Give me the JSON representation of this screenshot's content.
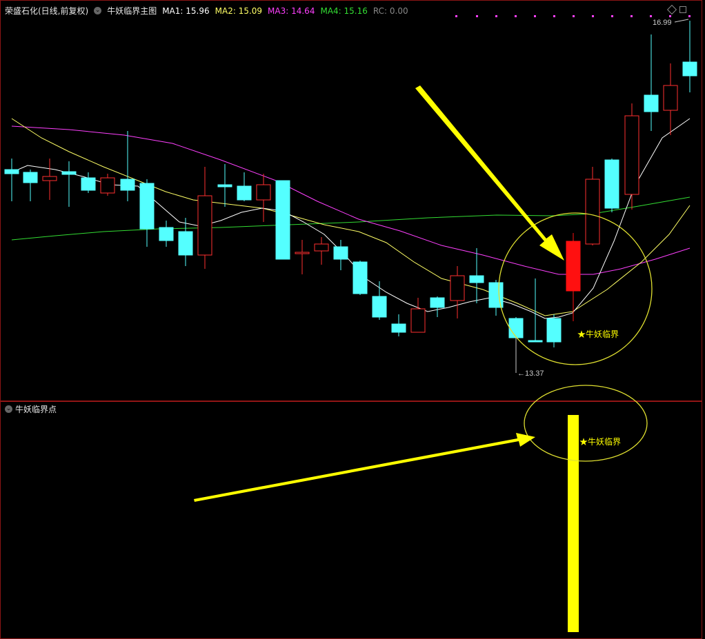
{
  "main": {
    "stock_title": "荣盛石化(日线,前复权)",
    "indicator_title": "牛妖临界主图",
    "ma_legend": [
      {
        "label": "MA1: 15.96",
        "color": "#ffffff"
      },
      {
        "label": "MA2: 15.09",
        "color": "#ffff66"
      },
      {
        "label": "MA3: 14.64",
        "color": "#ff40ff"
      },
      {
        "label": "MA4: 15.16",
        "color": "#33dd33"
      },
      {
        "label": "RC: 0.00",
        "color": "#777777"
      }
    ],
    "high_label": "16.99",
    "low_label": "13.37",
    "signal_label": "★牛妖临界"
  },
  "sub": {
    "indicator_title": "牛妖临界点",
    "signal_label": "★牛妖临界"
  },
  "colors": {
    "up": "#ff3030",
    "down": "#54ffff",
    "signal_candle": "#ff1010",
    "annotation": "#ffff00"
  }
}
